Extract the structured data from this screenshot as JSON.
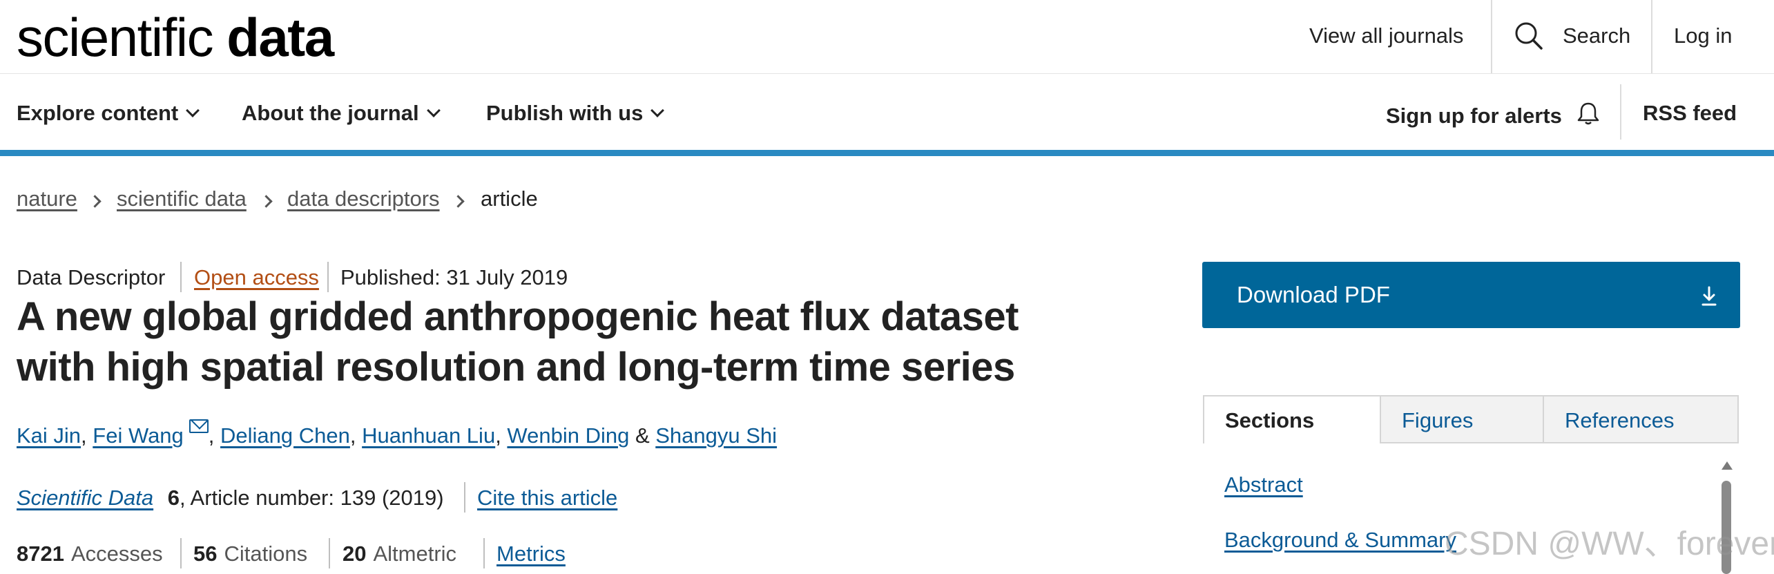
{
  "header": {
    "logo_light": "scientific",
    "logo_bold": "data",
    "view_all_journals": "View all journals",
    "search": "Search",
    "login": "Log in"
  },
  "nav": {
    "explore": "Explore content",
    "about": "About the journal",
    "publish": "Publish with us",
    "alerts": "Sign up for alerts",
    "rss": "RSS feed"
  },
  "breadcrumb": [
    "nature",
    "scientific data",
    "data descriptors",
    "article"
  ],
  "article": {
    "type": "Data Descriptor",
    "access": "Open access",
    "published": "Published: 31 July 2019",
    "title": "A new global gridded anthropogenic heat flux dataset with high spatial resolution and long-term time series",
    "authors": [
      "Kai Jin",
      "Fei Wang",
      "Deliang Chen",
      "Huanhuan Liu",
      "Wenbin Ding",
      "Shangyu Shi"
    ],
    "author_sep": ", ",
    "author_and": " & ",
    "journal": "Scientific Data",
    "volume": "6",
    "article_number": ", Article number: 139 (2019)",
    "cite": "Cite this article"
  },
  "metrics": {
    "accesses_value": "8721",
    "accesses_label": "Accesses",
    "citations_value": "56",
    "citations_label": "Citations",
    "altmetric_value": "20",
    "altmetric_label": "Altmetric",
    "metrics_link": "Metrics"
  },
  "sidebar": {
    "download": "Download PDF",
    "tabs": [
      "Sections",
      "Figures",
      "References"
    ],
    "toc": [
      "Abstract",
      "Background & Summary"
    ]
  },
  "watermark": "CSDN @WW、forever",
  "colors": {
    "accent_blue_rule": "#2a8ac2",
    "download_bg": "#006699",
    "link": "#0c5b96",
    "open_access": "#b24e14"
  }
}
